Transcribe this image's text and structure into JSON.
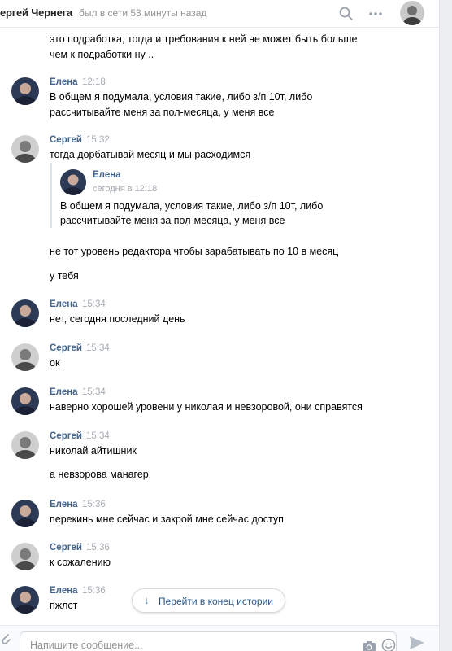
{
  "header": {
    "name": "ергей Чернега",
    "status": "был в сети 53 минуты назад",
    "search_icon": "search-icon",
    "more_icon": "more-icon"
  },
  "top_continuation": {
    "lines": [
      "это подработка, тогда и требования к ней не может быть больше",
      "чем к подработки ну .."
    ]
  },
  "messages": [
    {
      "author": "Елена",
      "time": "12:18",
      "lines": [
        "В общем я подумала, условия такие, либо з/п 10т, либо",
        "рассчитывайте меня за пол-месяца, у меня все"
      ]
    },
    {
      "author": "Сергей",
      "time": "15:32",
      "lines": [
        "тогда дорбатывай месяц и мы расходимся"
      ]
    },
    {
      "author": "Елена",
      "time": "15:34",
      "lines": [
        "нет, сегодня последний день"
      ]
    },
    {
      "author": "Сергей",
      "time": "15:34",
      "lines": [
        "ок"
      ]
    },
    {
      "author": "Елена",
      "time": "15:34",
      "lines": [
        "наверно хорошей уровени у николая и невзоровой, они справятся"
      ]
    },
    {
      "author": "Сергей",
      "time": "15:34",
      "lines": [
        "николай айтишник"
      ]
    },
    {
      "author": "Елена",
      "time": "15:36",
      "lines": [
        "перекинь мне сейчас и закрой мне сейчас доступ"
      ]
    },
    {
      "author": "Сергей",
      "time": "15:36",
      "lines": [
        "к сожалению"
      ]
    },
    {
      "author": "Елена",
      "time": "15:36",
      "lines": [
        "пжлст"
      ]
    }
  ],
  "quote": {
    "author": "Елена",
    "date": "сегодня в 12:18",
    "lines": [
      "В общем я подумала, условия такие, либо з/п 10т, либо",
      "рассчитывайте меня за пол-месяца, у меня все"
    ]
  },
  "followups": {
    "sergey_1532_a": "не тот уровень редактора чтобы зарабатывать по 10 в месяц",
    "sergey_1532_b": "у тебя",
    "sergey_1534_b": "а невзорова манагер"
  },
  "jump_button": {
    "label": "Перейти в конец истории",
    "icon": "arrow-down-icon"
  },
  "composer": {
    "placeholder": "Напишите сообщение...",
    "attach_icon": "paperclip-icon",
    "camera_icon": "camera-icon",
    "emoji_icon": "smile-icon",
    "send_icon": "send-icon"
  },
  "colors": {
    "name_link": "#42648b",
    "time": "#a6acb3",
    "accent": "#5181b8"
  }
}
